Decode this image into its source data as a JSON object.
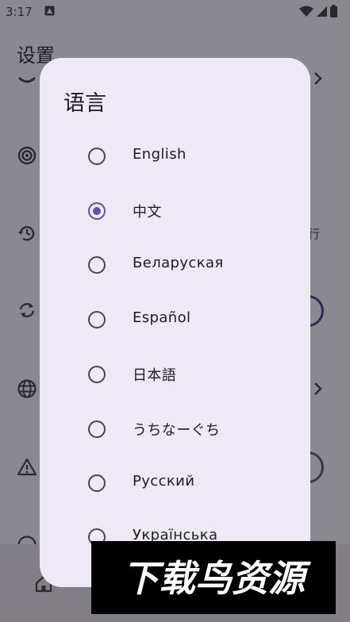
{
  "status_bar": {
    "time": "3:17"
  },
  "background_app": {
    "title": "设置",
    "trailing_text": "行"
  },
  "dialog": {
    "title": "语言",
    "options": [
      {
        "label": "English",
        "selected": false
      },
      {
        "label": "中文",
        "selected": true
      },
      {
        "label": "Беларуская",
        "selected": false
      },
      {
        "label": "Español",
        "selected": false
      },
      {
        "label": "日本語",
        "selected": false
      },
      {
        "label": "うちなーぐち",
        "selected": false
      },
      {
        "label": "Русский",
        "selected": false
      },
      {
        "label": "Українська",
        "selected": false
      }
    ]
  },
  "watermark": {
    "text": "下载鸟资源"
  },
  "colors": {
    "accent": "#6750a4",
    "dialog_bg": "#efe9f5",
    "scrim": "#8a8890"
  }
}
